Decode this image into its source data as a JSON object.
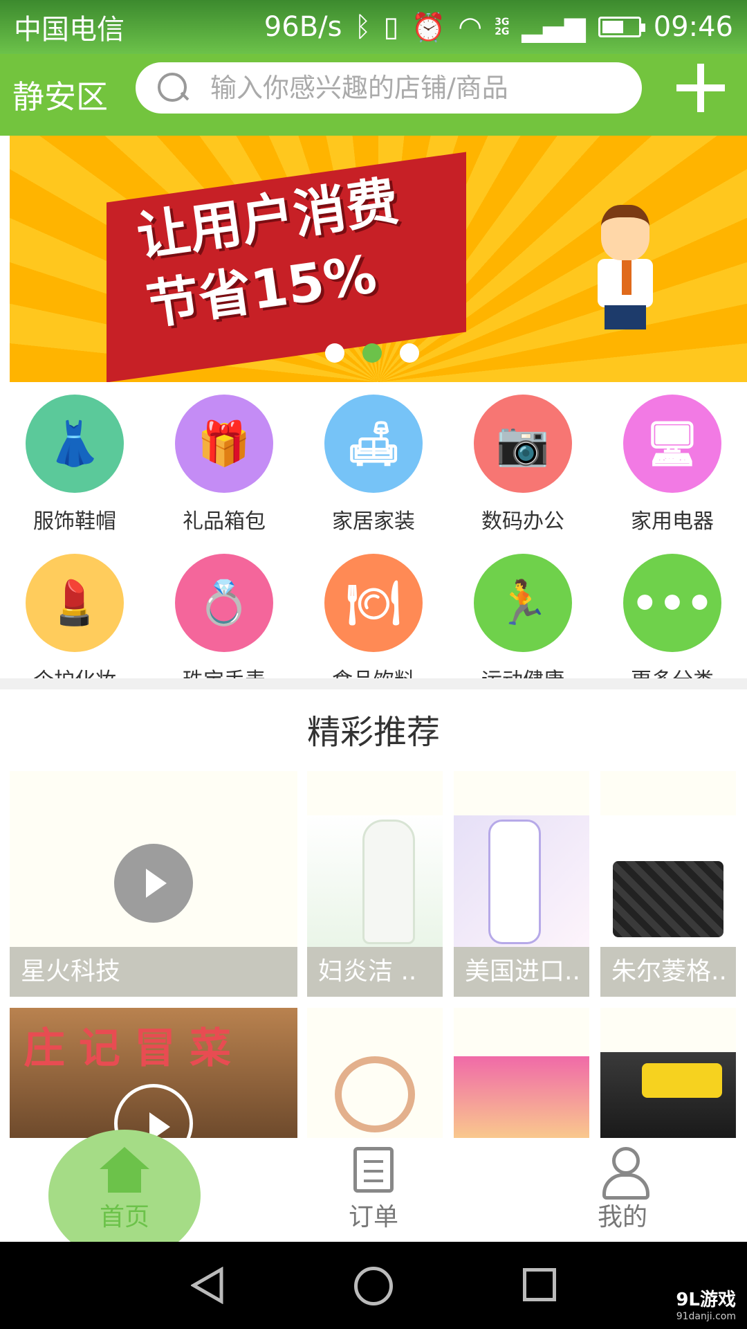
{
  "status_bar": {
    "carrier": "中国电信",
    "speed": "96B/s",
    "net_top": "3G",
    "net_bottom": "2G",
    "time": "09:46"
  },
  "header": {
    "district": "静安区",
    "search_placeholder": "输入你感兴趣的店铺/商品",
    "add_icon": "plus-icon"
  },
  "banner": {
    "line1": "让用户消费",
    "line2": "节省15%",
    "active_dot": 2,
    "dot_count": 3
  },
  "categories": [
    {
      "label": "服饰鞋帽",
      "icon": "dress-icon",
      "color": "#5bc99a",
      "glyph": "👗"
    },
    {
      "label": "礼品箱包",
      "icon": "gift-icon",
      "color": "#c48cf5",
      "glyph": "🎁"
    },
    {
      "label": "家居家装",
      "icon": "sofa-icon",
      "color": "#76c3f7",
      "glyph": "🛋"
    },
    {
      "label": "数码办公",
      "icon": "camera-icon",
      "color": "#f77673",
      "glyph": "📷"
    },
    {
      "label": "家用电器",
      "icon": "monitor-icon",
      "color": "#f27ae4",
      "glyph": "🖥"
    },
    {
      "label": "个护化妆",
      "icon": "cosmetics-icon",
      "color": "#ffcc5c",
      "glyph": "💄"
    },
    {
      "label": "珠宝手表",
      "icon": "ring-icon",
      "color": "#f4669b",
      "glyph": "💍"
    },
    {
      "label": "食品饮料",
      "icon": "food-cloche-icon",
      "color": "#ff8a55",
      "glyph": "🍽"
    },
    {
      "label": "运动健康",
      "icon": "running-icon",
      "color": "#6fd14b",
      "glyph": "🏃"
    },
    {
      "label": "更多分类",
      "icon": "more-dots-icon",
      "color": "#6fd14b",
      "glyph": "•••"
    }
  ],
  "recommend": {
    "title": "精彩推荐",
    "items": [
      {
        "caption": "星火科技",
        "has_video": true
      },
      {
        "caption": "妇炎洁 ..",
        "has_video": false
      },
      {
        "caption": "美国进口..",
        "has_video": false
      },
      {
        "caption": "朱尔菱格..",
        "has_video": false
      },
      {
        "sign": "庄记冒菜",
        "has_video": true
      }
    ]
  },
  "bottom_nav": {
    "home": "首页",
    "orders": "订单",
    "mine": "我的"
  },
  "watermark": {
    "brand": "9L游戏",
    "url": "91danji.com"
  },
  "colors": {
    "primary": "#73c43e",
    "accent_light": "#a5dc86"
  }
}
